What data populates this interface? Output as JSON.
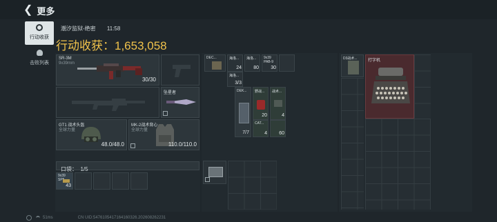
{
  "header": {
    "back_label": "更多"
  },
  "sidebar": {
    "items": [
      {
        "label": "行动收获",
        "active": true
      },
      {
        "label": "击败列表",
        "active": false
      }
    ]
  },
  "match": {
    "map": "潮汐监狱-绝密",
    "time": "11:58",
    "harvest_label": "行动收获：1,653,058"
  },
  "loadout": {
    "primary": {
      "name": "SR-3M",
      "caliber": "9x39mm",
      "ammo": "30/30"
    },
    "secondary_empty": true,
    "melee": {
      "name": "坠星者"
    },
    "helmet": {
      "name": "GT1 战术头盔",
      "sub": "全球力量",
      "durability": "48.0/48.0"
    },
    "armor": {
      "name": "MK-2战术背心",
      "sub": "全球力量",
      "durability": "110.0/110.0"
    },
    "pocket": {
      "label": "口袋：",
      "count": "1/5"
    },
    "pocket_item": {
      "name": "9x39",
      "sub": "SP5",
      "count": "43"
    }
  },
  "rig": {
    "items": [
      {
        "name": "DEC...",
        "count": ""
      },
      {
        "name": "海洛...",
        "count": "24"
      },
      {
        "name": "海洛...",
        "count": "80"
      },
      {
        "name": "9x39",
        "sub": "PAB-9",
        "count": "30"
      },
      {
        "name": "海洛...",
        "count": "3/3"
      },
      {
        "name": "DEK...",
        "count": "7/7"
      },
      {
        "name": "野战...",
        "count": "20"
      },
      {
        "name": "战术...",
        "count": "4"
      },
      {
        "name": "CAT...",
        "count": "4"
      },
      {
        "name": "",
        "count": "60"
      }
    ]
  },
  "backpack": {
    "items": [
      {
        "name": "D3战术..."
      },
      {
        "name": "打字机"
      }
    ]
  },
  "footer": {
    "ping": "51ms",
    "uid": "CN UID:5476105417164160326.202608262231"
  },
  "colors": {
    "accent": "#f0c24b",
    "rare_red": "#4a2a2e",
    "highlight": "#3e5045"
  }
}
